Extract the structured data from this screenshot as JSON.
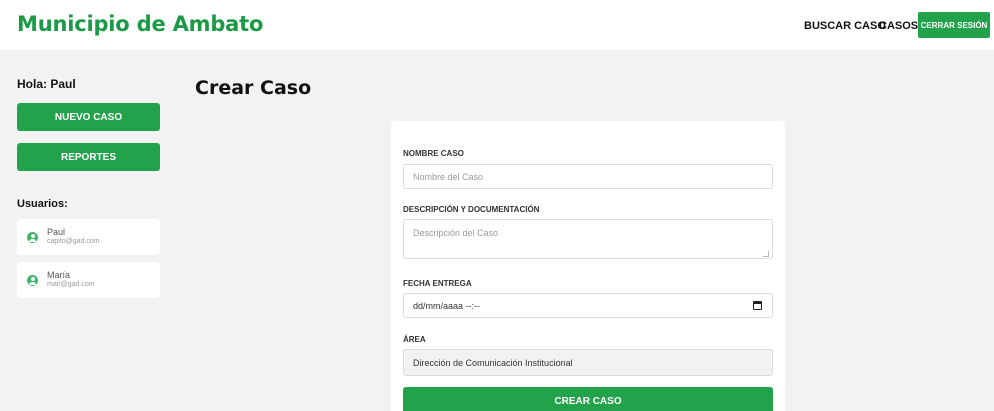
{
  "header": {
    "brand": "Municipio de Ambato",
    "nav": {
      "buscar_caso": "BUSCAR CASO",
      "casos": "CASOS"
    },
    "logout_label": "CERRAR SESIÓN"
  },
  "sidebar": {
    "greeting": "Hola: Paul",
    "new_case_label": "NUEVO CASO",
    "reports_label": "REPORTES",
    "users_title": "Usuarios:",
    "users": [
      {
        "name": "Paul",
        "email": "capito@gad.com",
        "icon": "user-circle-icon"
      },
      {
        "name": "María",
        "email": "mari@gad.com",
        "icon": "user-circle-icon"
      }
    ]
  },
  "main": {
    "title": "Crear Caso",
    "form": {
      "name_label": "NOMBRE CASO",
      "name_placeholder": "Nombre del Caso",
      "name_value": "",
      "desc_label": "DESCRIPCIÓN Y DOCUMENTACIÓN",
      "desc_placeholder": "Descripción del Caso",
      "desc_value": "",
      "date_label": "FECHA ENTREGA",
      "date_value": "dd/mm/aaaa --:--",
      "date_icon": "calendar-icon",
      "area_label": "ÁREA",
      "area_value": "Dirección de Comunicación Institucional",
      "submit_label": "CREAR CASO"
    }
  },
  "colors": {
    "brand_green": "#1b9a46",
    "button_green": "#22a24a",
    "background": "#f2f2f3"
  }
}
